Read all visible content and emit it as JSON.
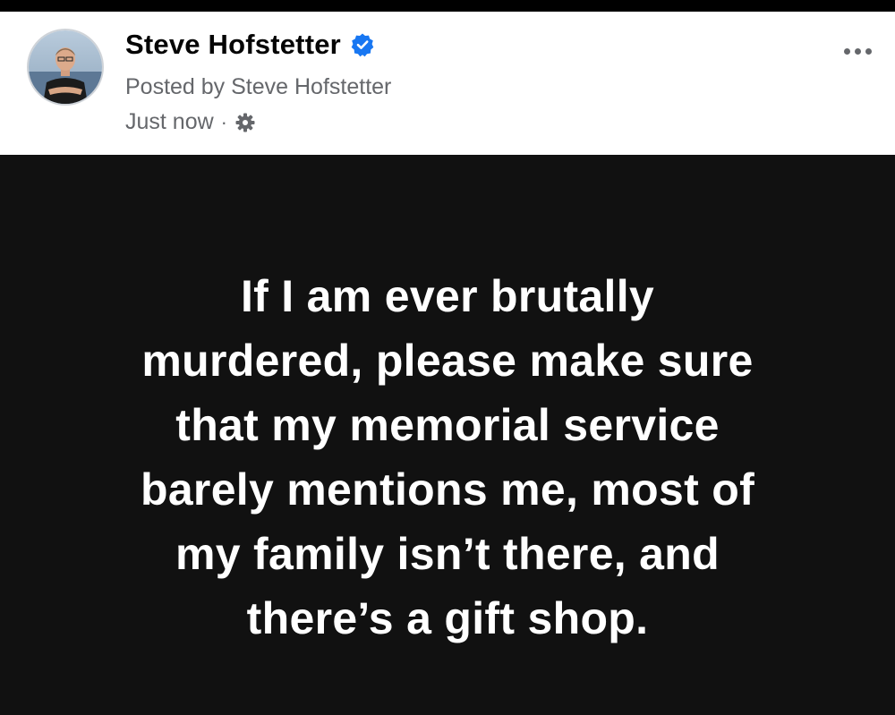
{
  "post": {
    "author_name": "Steve Hofstetter",
    "posted_by": "Posted by Steve Hofstetter",
    "timestamp": "Just now",
    "separator": "·",
    "icons": {
      "verified": "verified-badge-icon",
      "audience": "gear-icon",
      "more": "more-options-icon"
    },
    "colors": {
      "verified_blue": "#1877f2",
      "secondary_text": "#65676b",
      "post_background": "#111111",
      "post_text": "#ffffff"
    },
    "body_lines": [
      "If I am ever brutally",
      "murdered, please make sure",
      "that my memorial service",
      "barely mentions me, most of",
      "my family isn’t there, and",
      "there’s a gift shop."
    ]
  }
}
